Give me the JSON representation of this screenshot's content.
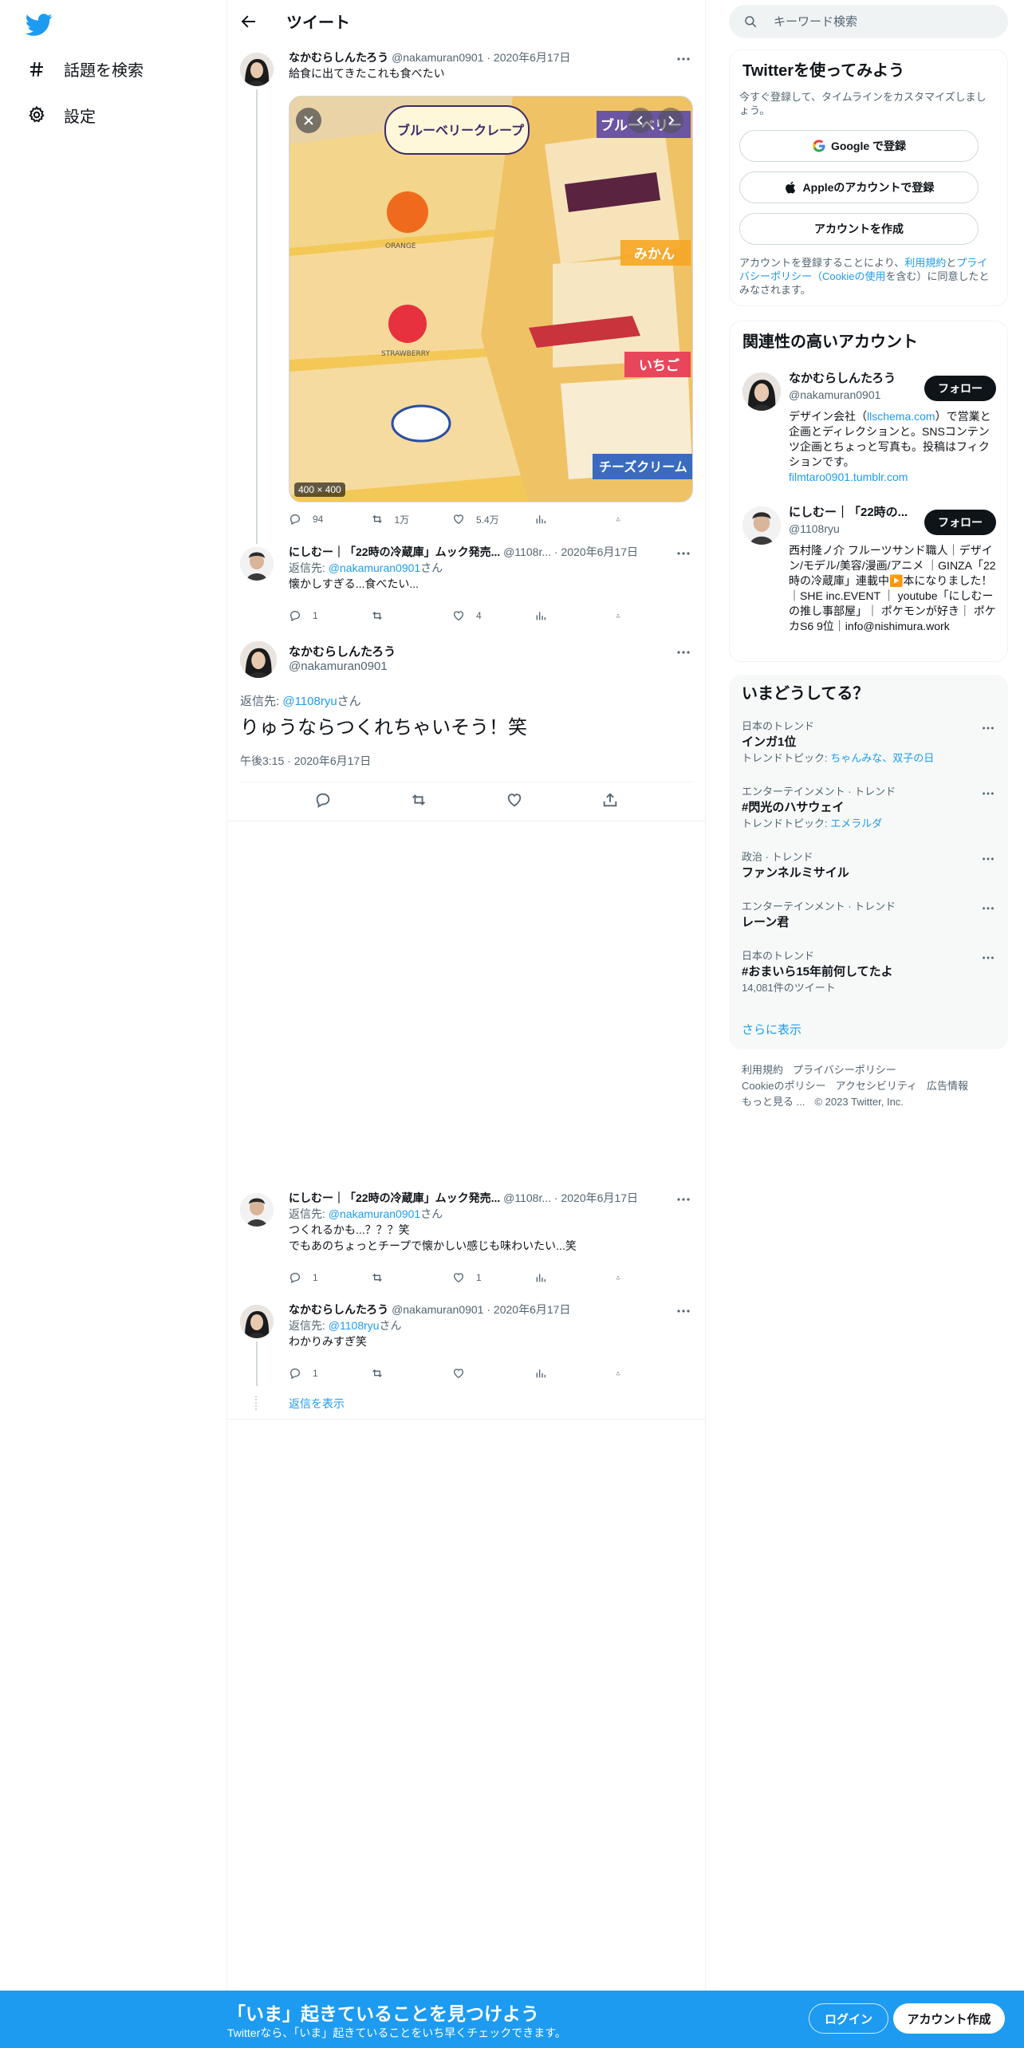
{
  "nav": {
    "items": [
      {
        "label": "話題を検索",
        "icon": "hashtag-icon"
      },
      {
        "label": "設定",
        "icon": "gear-icon"
      }
    ]
  },
  "header": {
    "title": "ツイート"
  },
  "tweet1": {
    "name": "なかむらしんたろう",
    "handle": "@nakamuran0901",
    "date": "2020年6月17日",
    "text": "給食に出てきたこれも食べたい",
    "media_size": "400 × 400",
    "media_texts": [
      "ブルーベリークレープ",
      "ブルーベリー",
      "ORANGE",
      "みかん",
      "STRAWBERRY",
      "いちご",
      "チーズクリーム"
    ],
    "replies": "94",
    "retweets": "1万",
    "likes": "5.4万"
  },
  "reply1": {
    "name": "にしむー｜「22時の冷蔵庫」ムック発売...",
    "handle": "@1108r...",
    "date": "2020年6月17日",
    "reply_to_label": "返信先:",
    "reply_to": "@nakamuran0901",
    "reply_suffix": "さん",
    "text": "懐かしすぎる...食べたい...",
    "replies": "1",
    "likes": "4"
  },
  "focus": {
    "name": "なかむらしんたろう",
    "handle": "@nakamuran0901",
    "reply_to_label": "返信先:",
    "reply_to": "@1108ryu",
    "reply_suffix": "さん",
    "text": "りゅうならつくれちゃいそう！笑",
    "time": "午後3:15 · 2020年6月17日"
  },
  "reply2": {
    "name": "にしむー｜「22時の冷蔵庫」ムック発売...",
    "handle": "@1108r...",
    "date": "2020年6月17日",
    "reply_to_label": "返信先:",
    "reply_to": "@nakamuran0901",
    "reply_suffix": "さん",
    "text1": "つくれるかも...？？？笑",
    "text2": "でもあのちょっとチープで懐かしい感じも味わいたい...笑",
    "replies": "1",
    "likes": "1"
  },
  "reply3": {
    "name": "なかむらしんたろう",
    "handle": "@nakamuran0901",
    "date": "2020年6月17日",
    "reply_to_label": "返信先:",
    "reply_to": "@1108ryu",
    "reply_suffix": "さん",
    "text": "わかりみすぎ笑",
    "replies": "1",
    "show_replies": "返信を表示"
  },
  "search": {
    "placeholder": "キーワード検索"
  },
  "signup": {
    "title": "Twitterを使ってみよう",
    "subtitle": "今すぐ登録して、タイムラインをカスタマイズしましょう。",
    "google": "Google で登録",
    "apple": "Appleのアカウントで登録",
    "create": "アカウントを作成",
    "terms_pre": "アカウントを登録することにより、",
    "terms_link": "利用規約",
    "terms_and": "と",
    "privacy_link": "プライバシーポリシー",
    "cookie_pre": "（",
    "cookie_link": "Cookieの使用",
    "terms_post": "を含む）に同意したとみなされます。"
  },
  "accounts": {
    "title": "関連性の高いアカウント",
    "follow_label": "フォロー",
    "items": [
      {
        "name": "なかむらしんたろう",
        "handle": "@nakamuran0901",
        "bio_pre": "デザイン会社（",
        "bio_link": "llschema.com",
        "bio_post": "）で営業と企画とディレクションと。SNSコンテンツ企画とちょっと写真も。投稿はフィクションです。",
        "bio_link2": "filmtaro0901.tumblr.com"
      },
      {
        "name": "にしむー｜「22時の...",
        "handle": "@1108ryu",
        "bio": "西村隆ノ介 フルーツサンド職人｜デザイン/モデル/美容/漫画/アニメ ｜GINZA「22時の冷蔵庫」連載中▶️本になりました！｜SHE inc.EVENT ｜ youtube「にしむーの推し事部屋」｜ ポケモンが好き｜ ポケカS6 9位｜info@nishimura.work"
      }
    ]
  },
  "trends": {
    "title": "いまどうしてる？",
    "items": [
      {
        "category": "日本のトレンド",
        "name": "インガ1位",
        "sub_label": "トレンドトピック: ",
        "sub_link": "ちゃんみな、双子の日"
      },
      {
        "category": "エンターテインメント · トレンド",
        "name": "#閃光のハサウェイ",
        "sub_label": "トレンドトピック: ",
        "sub_link": "エメラルダ"
      },
      {
        "category": "政治 · トレンド",
        "name": "ファンネルミサイル"
      },
      {
        "category": "エンターテインメント · トレンド",
        "name": "レーン君"
      },
      {
        "category": "日本のトレンド",
        "name": "#おまいら15年前何してたよ",
        "sub_plain": "14,081件のツイート"
      }
    ],
    "show_more": "さらに表示"
  },
  "footer": {
    "links": [
      "利用規約",
      "プライバシーポリシー",
      "Cookieのポリシー",
      "アクセシビリティ",
      "広告情報",
      "もっと見る ..."
    ],
    "copyright": "© 2023 Twitter, Inc."
  },
  "bottom_bar": {
    "headline": "「いま」起きていることを見つけよう",
    "subline": "Twitterなら、「いま」起きていることをいち早くチェックできます。",
    "login": "ログイン",
    "signup": "アカウント作成"
  },
  "colors": {
    "accent": "#1d9bf0",
    "text": "#0f1419",
    "muted": "#536471"
  }
}
